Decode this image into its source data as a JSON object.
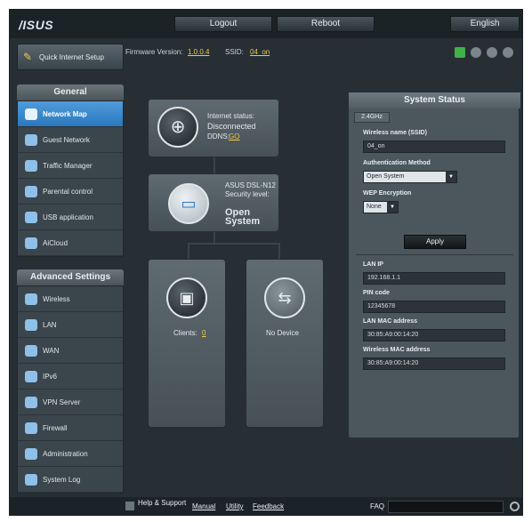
{
  "header": {
    "logo": "/ISUS",
    "logout_label": "Logout",
    "reboot_label": "Reboot",
    "language_label": "English"
  },
  "info": {
    "firmware_label": "Firmware Version:",
    "firmware_value": "1.0.0.4",
    "ssid_label": "SSID:",
    "ssid_value": "04_on"
  },
  "sidebar": {
    "qis_label": "Quick Internet Setup",
    "general_title": "General",
    "general_items": [
      {
        "label": "Network Map",
        "icon": "network-map-icon",
        "active": true
      },
      {
        "label": "Guest Network",
        "icon": "guest-network-icon"
      },
      {
        "label": "Traffic Manager",
        "icon": "traffic-manager-icon"
      },
      {
        "label": "Parental control",
        "icon": "parental-control-icon"
      },
      {
        "label": "USB application",
        "icon": "usb-application-icon"
      },
      {
        "label": "AiCloud",
        "icon": "aicloud-icon"
      }
    ],
    "advanced_title": "Advanced Settings",
    "advanced_items": [
      {
        "label": "Wireless",
        "icon": "wireless-icon"
      },
      {
        "label": "LAN",
        "icon": "lan-icon"
      },
      {
        "label": "WAN",
        "icon": "wan-icon"
      },
      {
        "label": "IPv6",
        "icon": "ipv6-icon"
      },
      {
        "label": "VPN Server",
        "icon": "vpn-icon"
      },
      {
        "label": "Firewall",
        "icon": "firewall-icon"
      },
      {
        "label": "Administration",
        "icon": "administration-icon"
      },
      {
        "label": "System Log",
        "icon": "system-log-icon"
      }
    ]
  },
  "map": {
    "internet": {
      "line1": "Internet status:",
      "line2": "Disconnected",
      "line3_label": "DDNS:",
      "line3_value": "GO"
    },
    "router": {
      "line1": "ASUS DSL-N12",
      "line2": "Security level:",
      "security": "Open System"
    },
    "clients": {
      "label": "Clients:",
      "value": "0"
    },
    "usb": {
      "label": "No Device"
    }
  },
  "status": {
    "title": "System Status",
    "tab": "2.4GHz",
    "ssid_label": "Wireless name (SSID)",
    "ssid_value": "04_on",
    "auth_label": "Authentication Method",
    "auth_value": "Open System",
    "wep_label": "WEP Encryption",
    "wep_value": "None",
    "apply_label": "Apply",
    "lan_ip_label": "LAN IP",
    "lan_ip_value": "192.168.1.1",
    "pin_label": "PIN code",
    "pin_value": "12345678",
    "lan_mac_label": "LAN MAC address",
    "lan_mac_value": "30:85:A9:00:14:20",
    "wl_mac_label": "Wireless MAC address",
    "wl_mac_value": "30:85:A9:00:14:20"
  },
  "footer": {
    "help_label": "Help & Support",
    "manual": "Manual",
    "utility": "Utility",
    "feedback": "Feedback",
    "faq": "FAQ"
  }
}
